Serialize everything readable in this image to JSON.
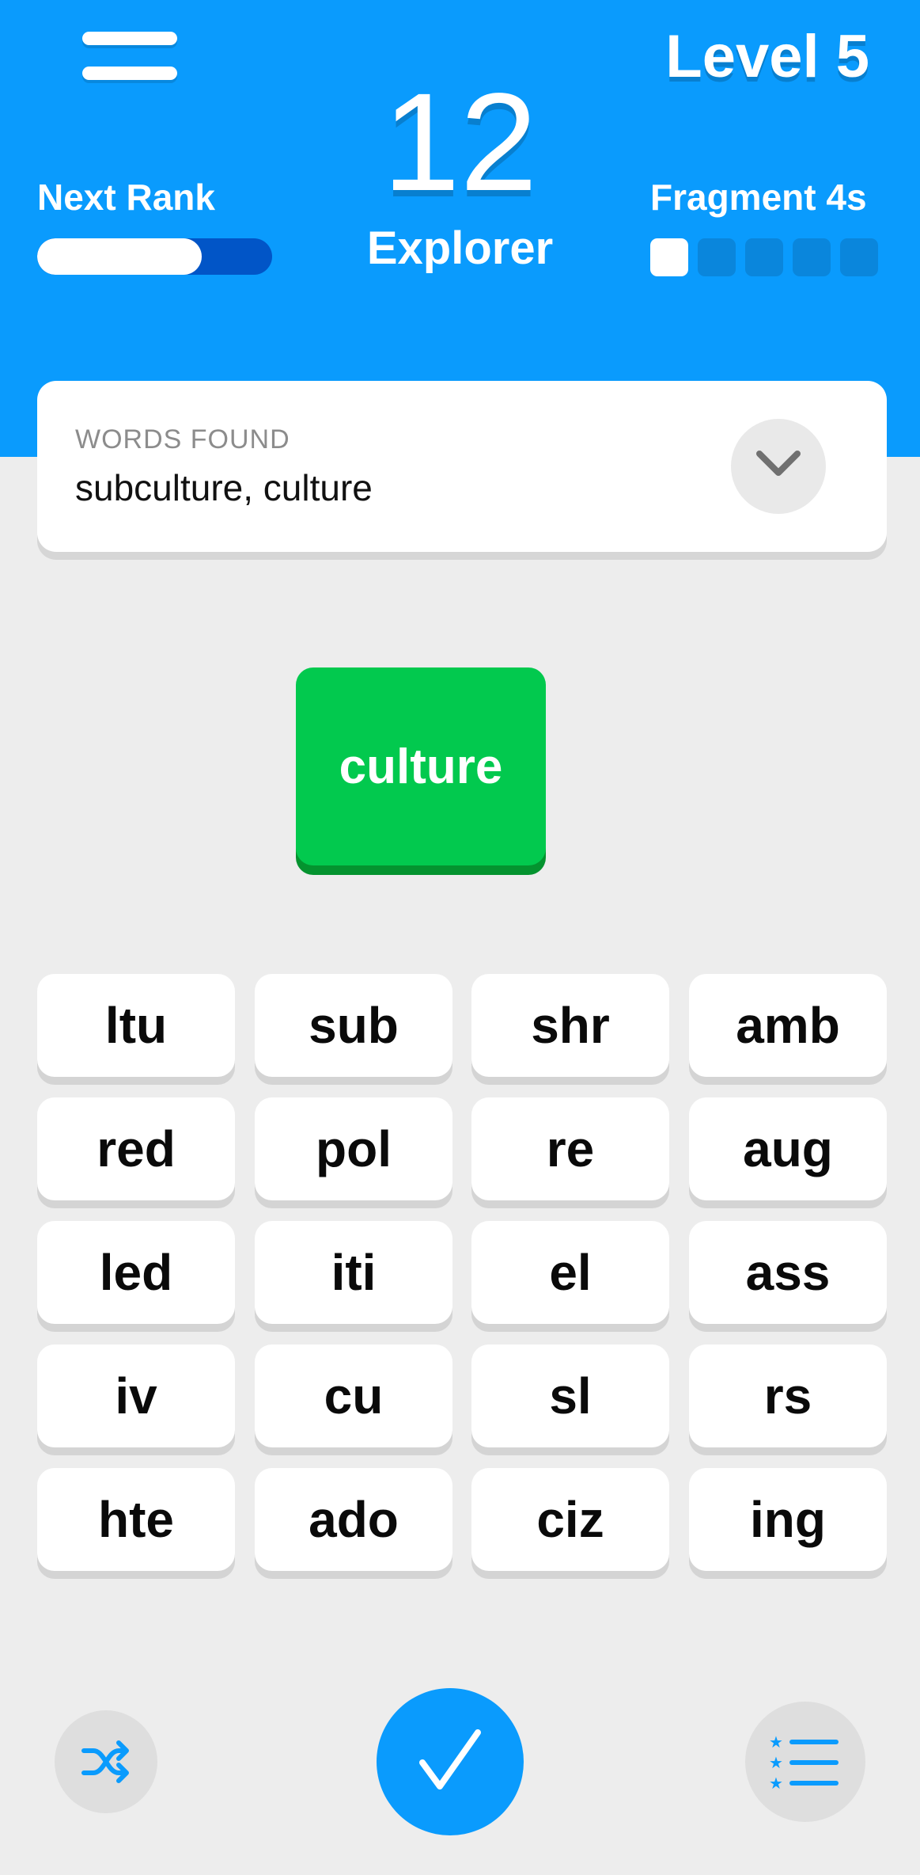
{
  "header": {
    "level": "Level 5",
    "score": "12",
    "rank_name": "Explorer",
    "next_rank_label": "Next Rank",
    "next_rank_progress": 0.7,
    "fragment_label": "Fragment 4s",
    "fragment_total": 5,
    "fragment_filled": 1,
    "color": "#0a9bfd"
  },
  "words_found": {
    "label": "WORDS FOUND",
    "list": "subculture, culture"
  },
  "current_word": {
    "text": "culture",
    "color": "#02c94e"
  },
  "tiles": [
    "ltu",
    "sub",
    "shr",
    "amb",
    "red",
    "pol",
    "re",
    "aug",
    "led",
    "iti",
    "el",
    "ass",
    "iv",
    "cu",
    "sl",
    "rs",
    "hte",
    "ado",
    "ciz",
    "ing"
  ],
  "icons": {
    "menu": "hamburger-menu-icon",
    "expand": "chevron-down-icon",
    "shuffle": "shuffle-icon",
    "submit": "checkmark-icon",
    "list": "starred-list-icon"
  }
}
